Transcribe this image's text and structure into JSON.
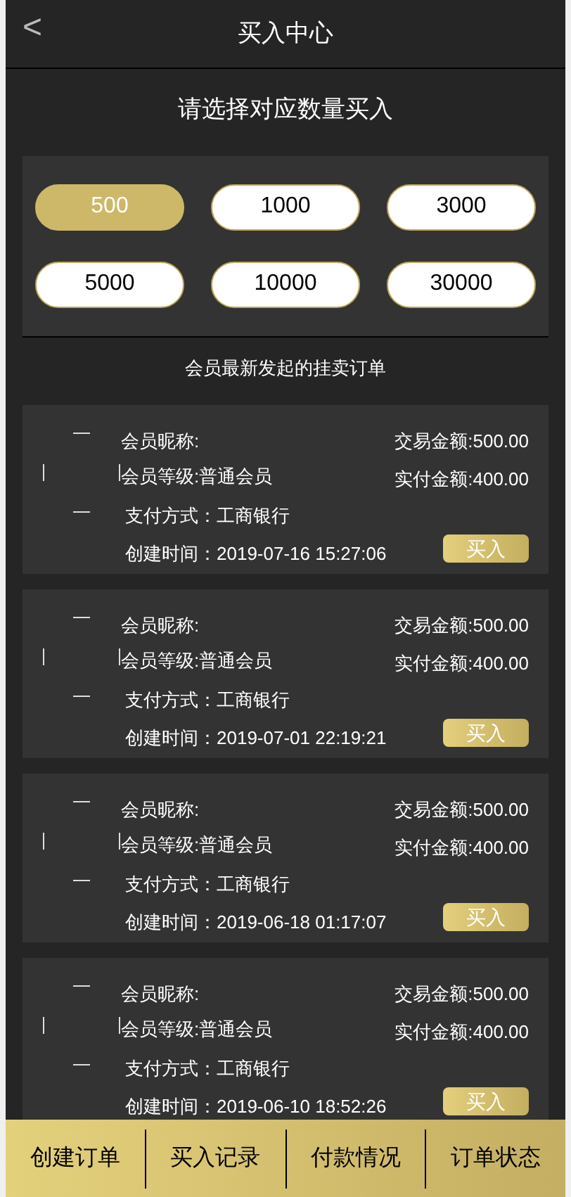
{
  "header": {
    "back": "<",
    "title": "买入中心"
  },
  "prompt": "请选择对应数量买入",
  "amounts": [
    {
      "label": "500",
      "selected": true
    },
    {
      "label": "1000",
      "selected": false
    },
    {
      "label": "3000",
      "selected": false
    },
    {
      "label": "5000",
      "selected": false
    },
    {
      "label": "10000",
      "selected": false
    },
    {
      "label": "30000",
      "selected": false
    }
  ],
  "section_title": "会员最新发起的挂卖订单",
  "orders": [
    {
      "nickname": "会员昵称:",
      "level": "会员等级:普通会员",
      "payment": "支付方式：工商银行",
      "created": "创建时间：2019-07-16 15:27:06",
      "trade_amount": "交易金额:500.00",
      "paid_amount": "实付金额:400.00",
      "button": "买入"
    },
    {
      "nickname": "会员昵称:",
      "level": "会员等级:普通会员",
      "payment": "支付方式：工商银行",
      "created": "创建时间：2019-07-01 22:19:21",
      "trade_amount": "交易金额:500.00",
      "paid_amount": "实付金额:400.00",
      "button": "买入"
    },
    {
      "nickname": "会员昵称:",
      "level": "会员等级:普通会员",
      "payment": "支付方式：工商银行",
      "created": "创建时间：2019-06-18 01:17:07",
      "trade_amount": "交易金额:500.00",
      "paid_amount": "实付金额:400.00",
      "button": "买入"
    },
    {
      "nickname": "会员昵称:",
      "level": "会员等级:普通会员",
      "payment": "支付方式：工商银行",
      "created": "创建时间：2019-06-10 18:52:26",
      "trade_amount": "交易金额:500.00",
      "paid_amount": "实付金额:400.00",
      "button": "买入"
    }
  ],
  "tab_bar": [
    "创建订单",
    "买入记录",
    "付款情况",
    "订单状态"
  ]
}
